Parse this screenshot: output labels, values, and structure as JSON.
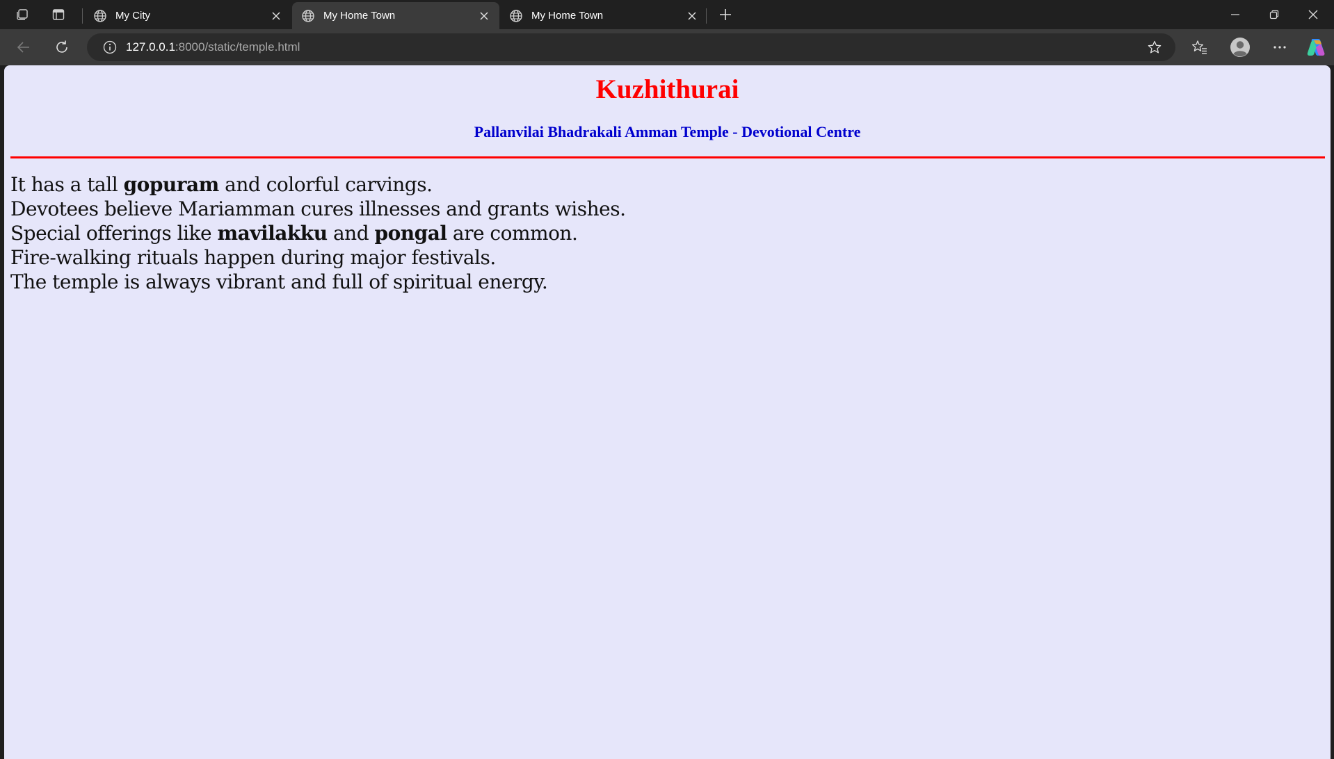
{
  "browser": {
    "tabs": [
      {
        "title": "My City",
        "active": false
      },
      {
        "title": "My Home Town",
        "active": true
      },
      {
        "title": "My Home Town",
        "active": false
      }
    ],
    "url_host": "127.0.0.1",
    "url_rest": ":8000/static/temple.html",
    "icons": [
      "workspaces-icon",
      "tab-actions-icon",
      "globe-icon",
      "close-icon",
      "new-tab-icon",
      "minimize-icon",
      "restore-icon",
      "close-window-icon",
      "back-icon",
      "reload-icon",
      "site-info-icon",
      "favorite-star-icon",
      "favorites-icon",
      "profile-icon",
      "more-icon",
      "copilot-icon"
    ]
  },
  "page": {
    "title": "Kuzhithurai",
    "subtitle": "Pallanvilai Bhadrakali Amman Temple - Devotional Centre",
    "colors": {
      "background": "#e6e6fa",
      "title": "#ff0000",
      "subtitle": "#0000cd",
      "rule": "#ff0000"
    },
    "lines": [
      {
        "pre": "It has a tall ",
        "bold1": "gopuram",
        "mid": " and colorful carvings.",
        "bold2": "",
        "post": ""
      },
      {
        "pre": "Devotees believe Mariamman cures illnesses and grants wishes.",
        "bold1": "",
        "mid": "",
        "bold2": "",
        "post": ""
      },
      {
        "pre": "Special offerings like ",
        "bold1": "mavilakku",
        "mid": " and ",
        "bold2": "pongal",
        "post": " are common."
      },
      {
        "pre": "Fire-walking rituals happen during major festivals.",
        "bold1": "",
        "mid": "",
        "bold2": "",
        "post": ""
      },
      {
        "pre": "The temple is always vibrant and full of spiritual energy.",
        "bold1": "",
        "mid": "",
        "bold2": "",
        "post": ""
      }
    ]
  }
}
